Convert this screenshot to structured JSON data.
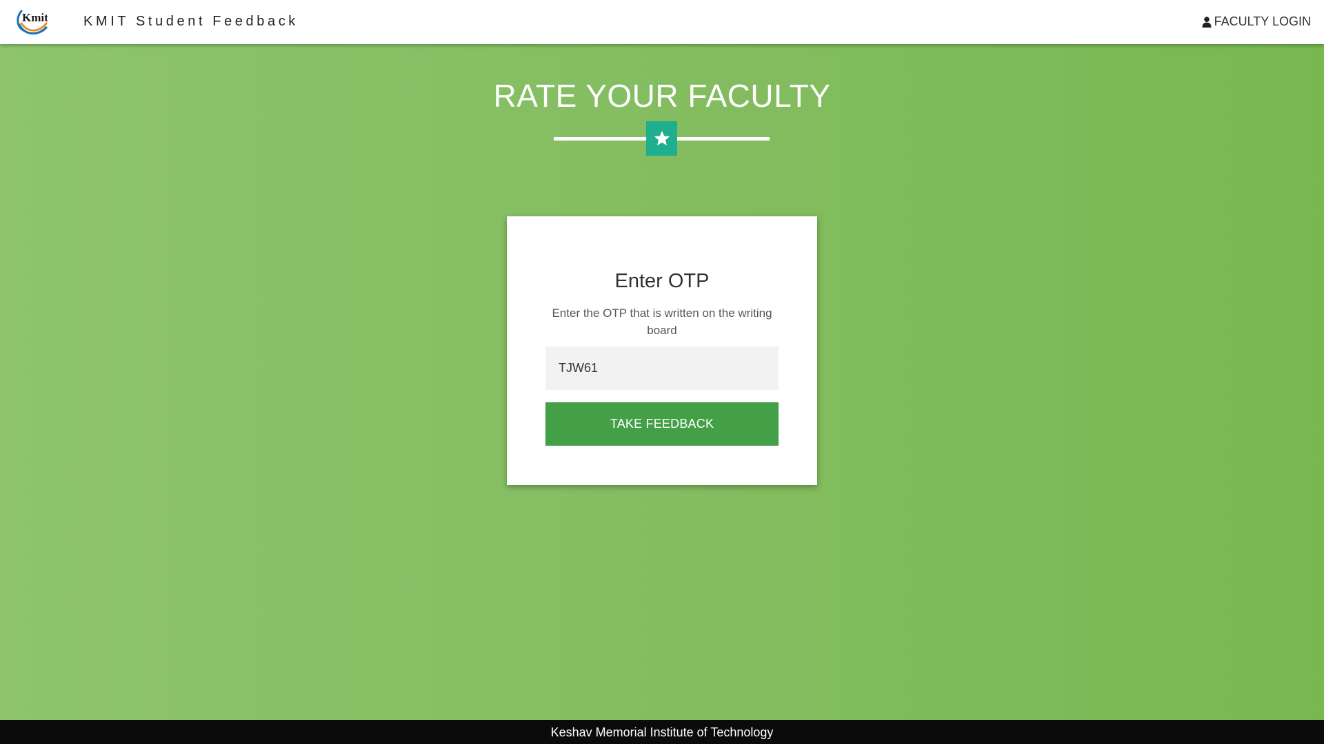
{
  "navbar": {
    "brand": "KMIT Student Feedback",
    "logo_text": "Kmit",
    "faculty_login_label": "FACULTY LOGIN",
    "faculty_login_icon": "user-icon"
  },
  "hero": {
    "title": "RATE YOUR FACULTY",
    "divider_icon": "star-icon"
  },
  "card": {
    "title": "Enter OTP",
    "description": "Enter the OTP that is written on the writing board",
    "otp_value": "TJW61",
    "submit_label": "TAKE FEEDBACK"
  },
  "footer": {
    "text": "Keshav Memorial Institute of Technology"
  },
  "colors": {
    "background_green": "#84bd61",
    "star_box": "#1fae8f",
    "button_green": "#43a047",
    "footer_bg": "#0b0b0b",
    "input_bg": "#f2f2f2"
  }
}
